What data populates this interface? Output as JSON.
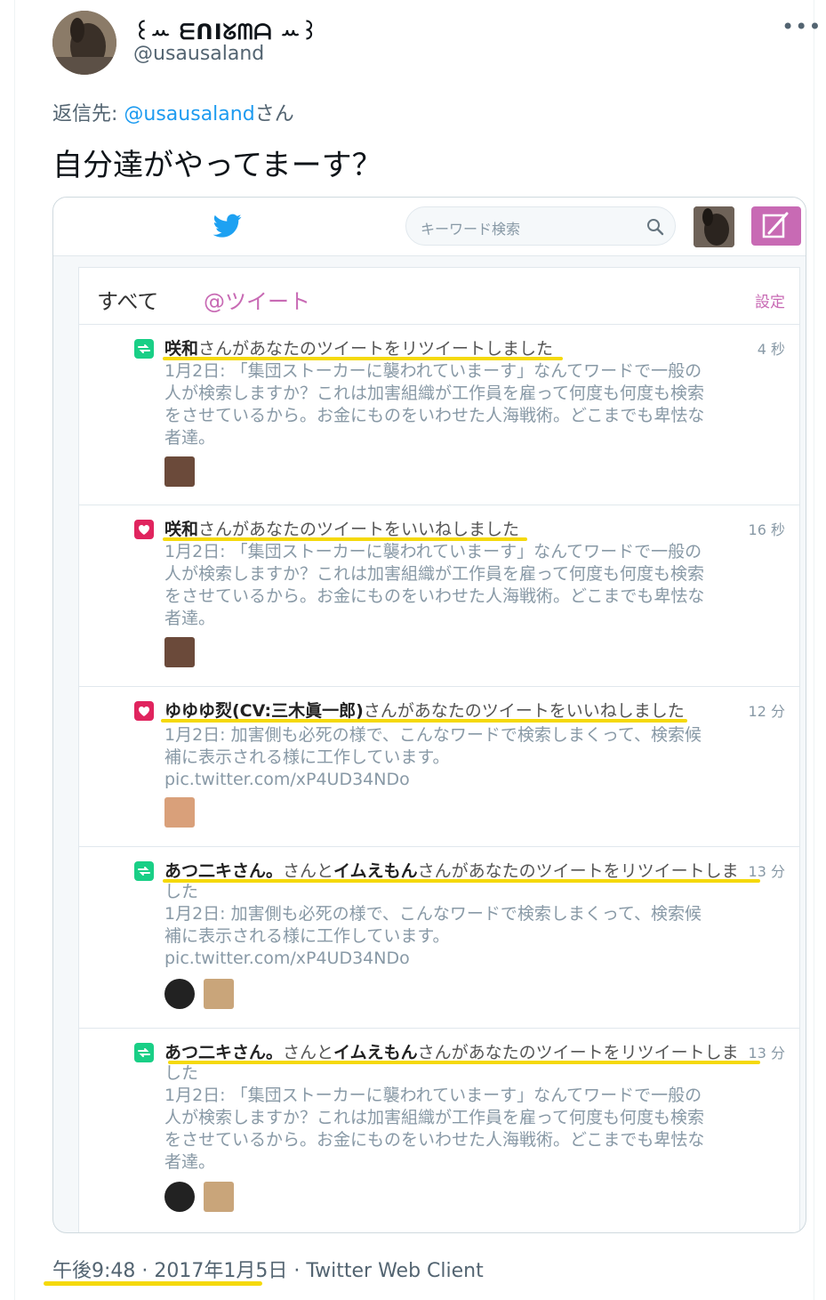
{
  "tweet": {
    "display_name": "꒰ꕀ ᗴᑎIᘜᗰᗩ ꕀ꒱",
    "handle": "@usausaland",
    "more_label": "•••",
    "reply_prefix": "返信先: ",
    "reply_mention": "@usausaland",
    "reply_suffix": "さん",
    "text": "自分達がやってまーす？",
    "footer": "午後9:48 · 2017年1月5日 · Twitter Web Client"
  },
  "embedded": {
    "search_placeholder": "キーワード検索",
    "tab_all": "すべて",
    "tab_mentions": "@ツイート",
    "settings_label": "設定",
    "items": [
      {
        "type": "retweet",
        "actor": "咲和",
        "action": "さんがあなたのツイートをリツイートしました",
        "time": "4 秒",
        "body": "1月2日: 「集団ストーカーに襲われていまーす」なんてワードで一般の人が検索しますか？これは加害組織が工作員を雇って何度も何度も検索をさせているから。お金にものをいわせた人海戦術。どこまでも卑怯な者達。"
      },
      {
        "type": "like",
        "actor": "咲和",
        "action": "さんがあなたのツイートをいいねしました",
        "time": "16 秒",
        "body": "1月2日: 「集団ストーカーに襲われていまーす」なんてワードで一般の人が検索しますか？これは加害組織が工作員を雇って何度も何度も検索をさせているから。お金にものをいわせた人海戦術。どこまでも卑怯な者達。"
      },
      {
        "type": "like",
        "actor": "ゆゆゆ烮(CV:三木眞一郎)",
        "action": "さんがあなたのツイートをいいねしました",
        "time": "12 分",
        "body": "1月2日: 加害側も必死の様で、こんなワードで検索しまくって、検索候補に表示される様に工作しています。",
        "link": "pic.twitter.com/xP4UD34NDo"
      },
      {
        "type": "retweet",
        "actor": "あつ二キさん。",
        "joiner": "さんと",
        "actor2": "イムえもん",
        "action": "さんがあなたのツイートをリツイートしま",
        "wrap": "した",
        "time": "13 分",
        "body": "1月2日: 加害側も必死の様で、こんなワードで検索しまくって、検索候補に表示される様に工作しています。",
        "link": "pic.twitter.com/xP4UD34NDo"
      },
      {
        "type": "retweet",
        "actor": "あつ二キさん。",
        "joiner": "さんと",
        "actor2": "イムえもん",
        "action": "さんがあなたのツイートをリツイートしま",
        "wrap": "した",
        "time": "13 分",
        "body": "1月2日: 「集団ストーカーに襲われていまーす」なんてワードで一般の人が検索しますか？これは加害組織が工作員を雇って何度も何度も検索をさせているから。お金にものをいわせた人海戦術。どこまでも卑怯な者達。"
      }
    ]
  },
  "colors": {
    "link_blue": "#1d9bf0",
    "accent_pink": "#c86ab4",
    "retweet_green": "#19cf86",
    "like_red": "#e0245e",
    "highlight_yellow": "#f5d90a"
  },
  "icons": [
    "twitter-bird-icon",
    "search-icon",
    "compose-icon",
    "retweet-icon",
    "heart-icon",
    "more-icon"
  ]
}
